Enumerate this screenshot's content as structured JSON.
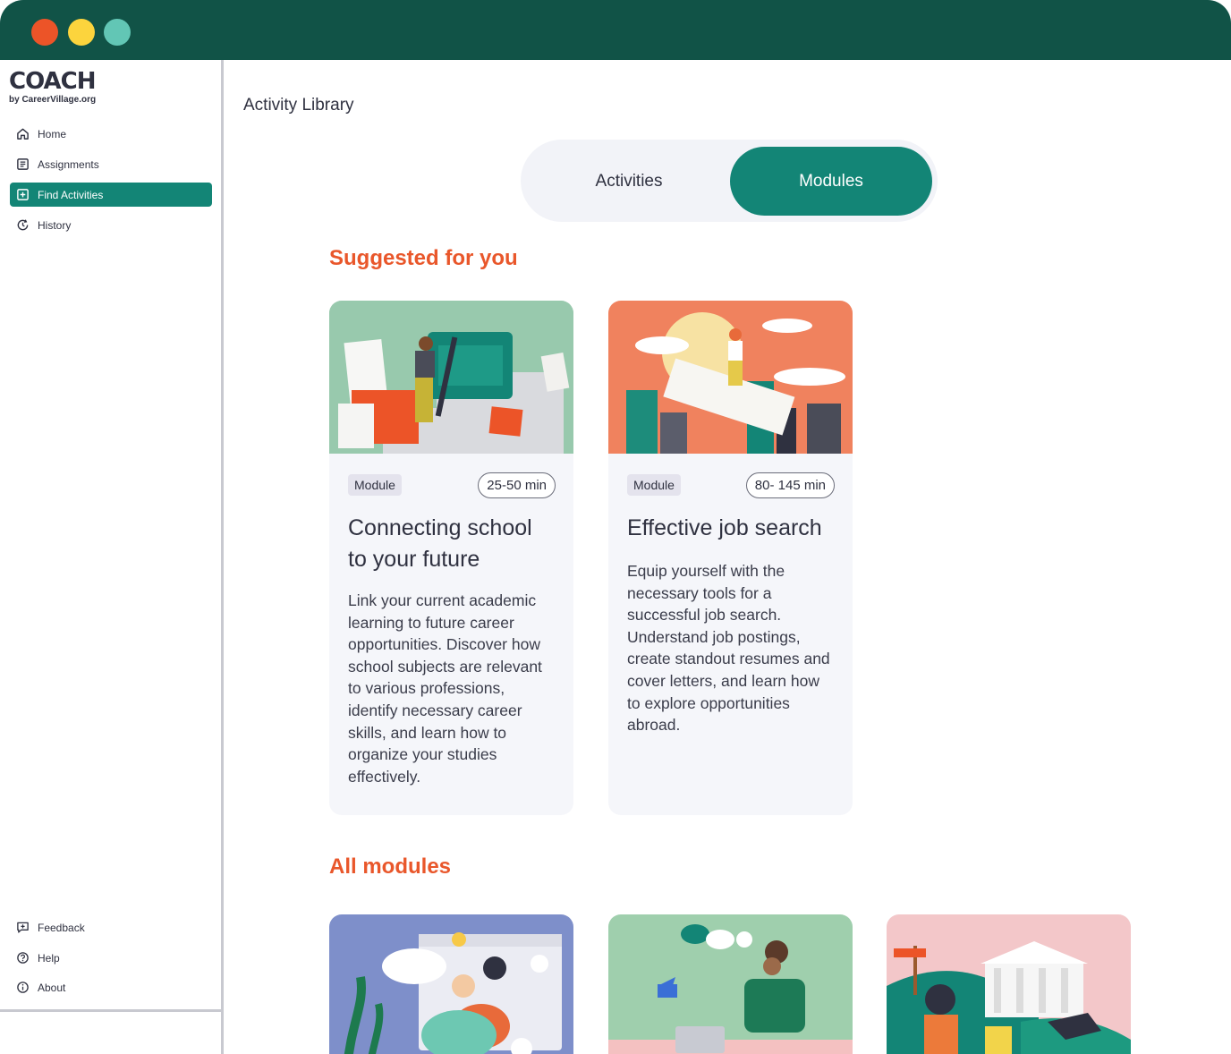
{
  "sidebar": {
    "logo_main": "COACH",
    "logo_sub": "by CareerVillage.org",
    "nav": [
      {
        "label": "Home",
        "icon": "home-icon"
      },
      {
        "label": "Assignments",
        "icon": "assignments-icon"
      },
      {
        "label": "Find Activities",
        "icon": "add-box-icon",
        "active": true
      },
      {
        "label": "History",
        "icon": "history-icon"
      }
    ],
    "footer_nav": [
      {
        "label": "Feedback",
        "icon": "feedback-icon"
      },
      {
        "label": "Help",
        "icon": "help-icon"
      },
      {
        "label": "About",
        "icon": "info-icon"
      }
    ]
  },
  "main": {
    "title": "Activity Library",
    "toggle": {
      "activities": "Activities",
      "modules": "Modules",
      "selected": "Modules"
    },
    "suggested_heading": "Suggested for you",
    "all_heading": "All modules",
    "suggested": [
      {
        "tag": "Module",
        "duration": "25-50 min",
        "title": "Connecting school to your future",
        "description": "Link your current academic learning to future career opportunities. Discover how school subjects are relevant to various professions, identify necessary career skills, and learn how to organize your studies effectively."
      },
      {
        "tag": "Module",
        "duration": "80- 145 min",
        "title": "Effective job search",
        "description": "Equip yourself with the necessary tools for a successful job search. Understand job postings, create standout resumes and cover letters, and learn how to explore opportunities abroad."
      }
    ]
  },
  "colors": {
    "window_bar": "#115347",
    "accent": "#138576",
    "heading_orange": "#e9572b"
  }
}
